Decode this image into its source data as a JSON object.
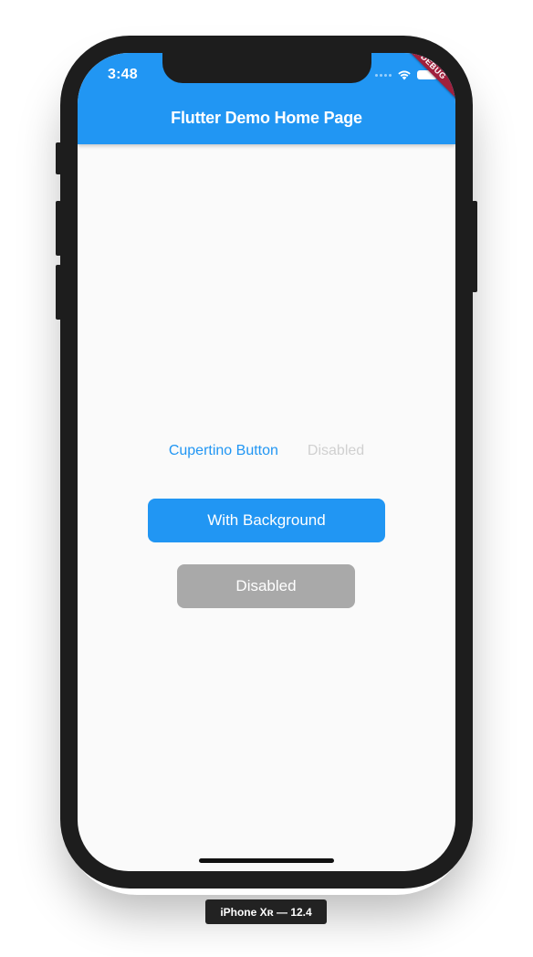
{
  "status_bar": {
    "time": "3:48"
  },
  "app_bar": {
    "title": "Flutter Demo Home Page",
    "color": "#2196f3"
  },
  "debug_banner": {
    "label": "DEBUG",
    "color": "#a0203c"
  },
  "content": {
    "cupertino_button_label": "Cupertino Button",
    "disabled_text_button_label": "Disabled",
    "with_background_button_label": "With Background",
    "disabled_filled_button_label": "Disabled"
  },
  "device": {
    "label": "iPhone Xʀ — 12.4"
  },
  "icons": [
    "wifi-icon",
    "battery-icon",
    "signal-dots-icon"
  ]
}
